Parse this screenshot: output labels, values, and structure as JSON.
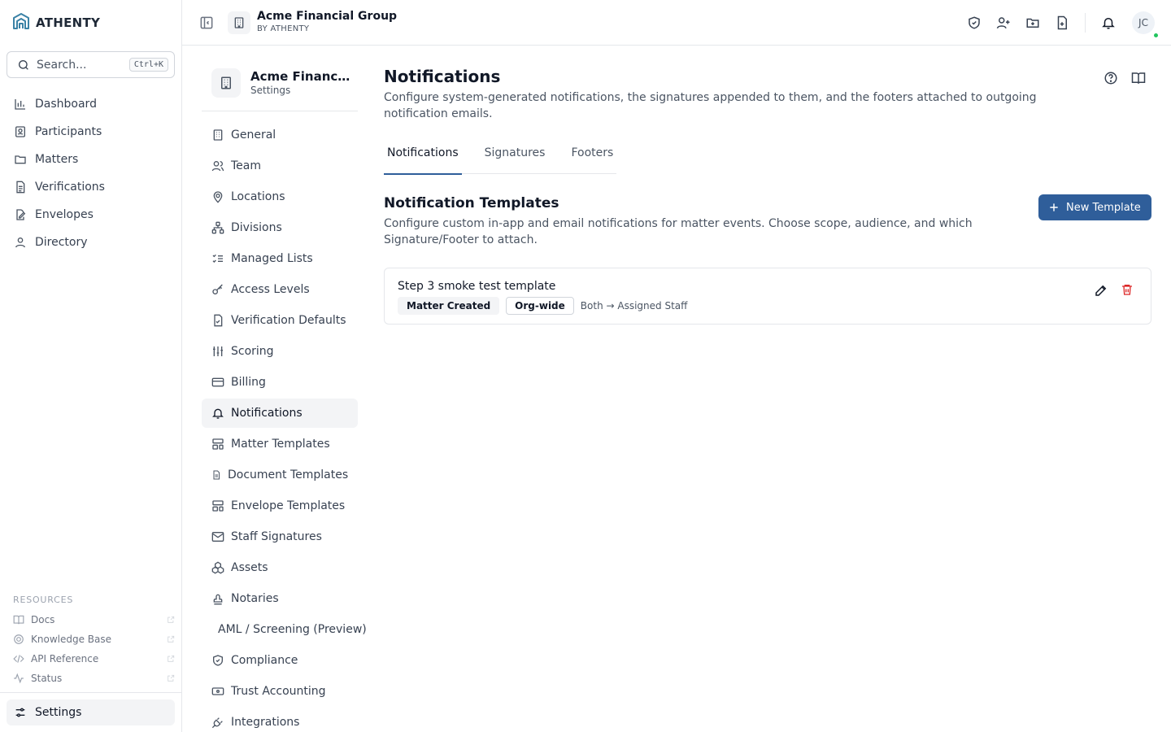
{
  "brand": {
    "name": "ATHENTY",
    "accent": "#2f5e9a",
    "logo_color": "#3b82a6"
  },
  "search": {
    "placeholder": "Search...",
    "shortcut": "Ctrl+K"
  },
  "nav": {
    "items": [
      {
        "label": "Dashboard",
        "icon": "bar-chart-icon"
      },
      {
        "label": "Participants",
        "icon": "id-badge-icon"
      },
      {
        "label": "Matters",
        "icon": "folder-icon"
      },
      {
        "label": "Verifications",
        "icon": "file-text-icon"
      },
      {
        "label": "Envelopes",
        "icon": "file-signature-icon"
      },
      {
        "label": "Directory",
        "icon": "user-icon"
      }
    ]
  },
  "resources": {
    "title": "RESOURCES",
    "items": [
      {
        "label": "Docs",
        "icon": "book-icon"
      },
      {
        "label": "Knowledge Base",
        "icon": "lifebuoy-icon"
      },
      {
        "label": "API Reference",
        "icon": "code-icon"
      },
      {
        "label": "Status",
        "icon": "activity-icon"
      }
    ]
  },
  "settings_link": {
    "label": "Settings",
    "icon": "sliders-icon"
  },
  "topbar": {
    "org_name": "Acme Financial Group",
    "org_by": "BY ATHENTY",
    "user_initials": "JC",
    "actions": [
      "shield-check-icon",
      "user-plus-icon",
      "folder-plus-icon",
      "file-plus-icon",
      "bell-icon"
    ]
  },
  "settings_nav": {
    "header_title": "Acme Financial Group",
    "header_subtitle": "Settings",
    "items": [
      {
        "label": "General",
        "icon": "building-icon"
      },
      {
        "label": "Team",
        "icon": "users-icon"
      },
      {
        "label": "Locations",
        "icon": "map-pin-icon"
      },
      {
        "label": "Divisions",
        "icon": "network-icon"
      },
      {
        "label": "Managed Lists",
        "icon": "list-checks-icon"
      },
      {
        "label": "Access Levels",
        "icon": "key-icon"
      },
      {
        "label": "Verification Defaults",
        "icon": "file-check-icon"
      },
      {
        "label": "Scoring",
        "icon": "sliders-vertical-icon"
      },
      {
        "label": "Billing",
        "icon": "credit-card-icon"
      },
      {
        "label": "Notifications",
        "icon": "bell-icon",
        "active": true
      },
      {
        "label": "Matter Templates",
        "icon": "layout-template-icon"
      },
      {
        "label": "Document Templates",
        "icon": "small-file-icon"
      },
      {
        "label": "Envelope Templates",
        "icon": "layout-template-icon"
      },
      {
        "label": "Staff Signatures",
        "icon": "mail-icon"
      },
      {
        "label": "Assets",
        "icon": "boxes-icon"
      },
      {
        "label": "Notaries",
        "icon": "stamp-icon"
      },
      {
        "label": "AML / Screening (Preview)",
        "icon": ""
      },
      {
        "label": "Compliance",
        "icon": "shield-check-icon"
      },
      {
        "label": "Trust Accounting",
        "icon": "banknote-icon"
      },
      {
        "label": "Integrations",
        "icon": "plug-icon"
      }
    ]
  },
  "page": {
    "title": "Notifications",
    "description": "Configure system-generated notifications, the signatures appended to them, and the footers attached to outgoing notification emails.",
    "tabs": [
      {
        "label": "Notifications",
        "active": true
      },
      {
        "label": "Signatures",
        "active": false
      },
      {
        "label": "Footers",
        "active": false
      }
    ],
    "header_icons": [
      "help-circle-icon",
      "book-open-icon"
    ]
  },
  "templates": {
    "title": "Notification Templates",
    "description": "Configure custom in-app and email notifications for matter events. Choose scope, audience, and which Signature/Footer to attach.",
    "new_button": "New Template",
    "items": [
      {
        "name": "Step 3 smoke test template",
        "event": "Matter Created",
        "scope": "Org-wide",
        "audience": "Both → Assigned Staff"
      }
    ]
  }
}
